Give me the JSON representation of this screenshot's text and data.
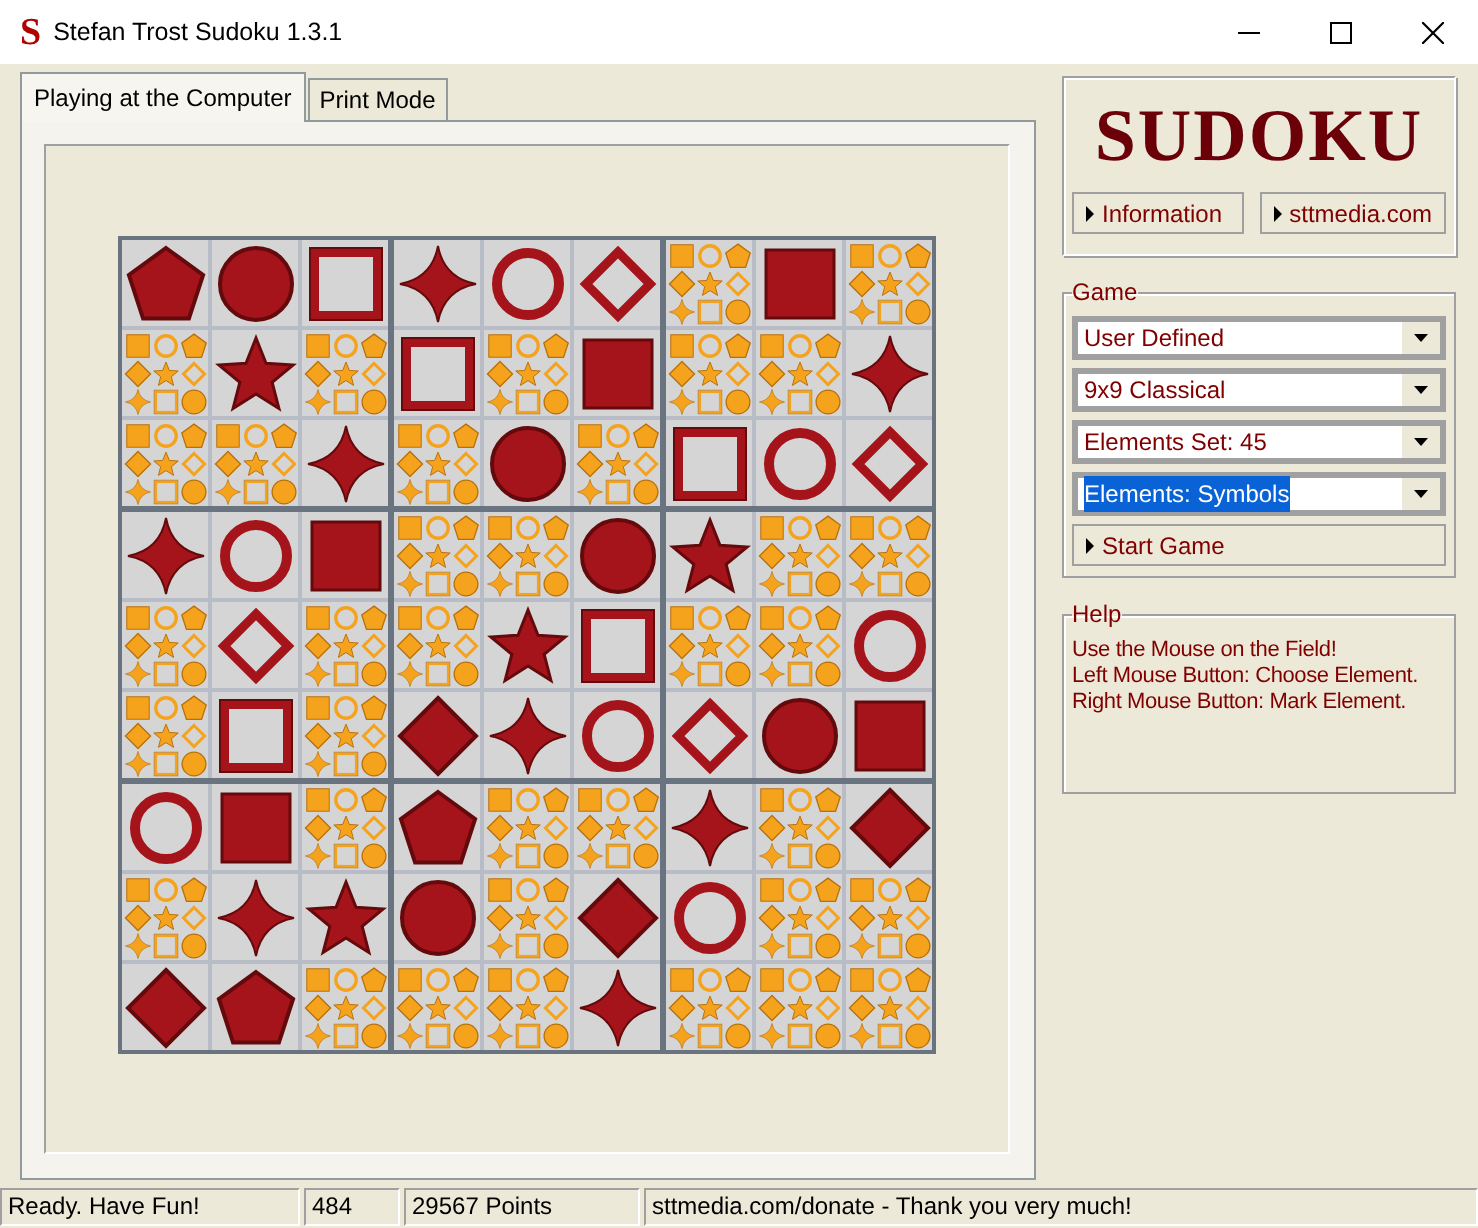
{
  "window": {
    "icon_letter": "S",
    "title": "Stefan Trost Sudoku 1.3.1"
  },
  "tabs": [
    {
      "label": "Playing at the Computer",
      "selected": true
    },
    {
      "label": "Print Mode",
      "selected": false
    }
  ],
  "board": {
    "rows": [
      [
        {
          "kind": "pentagon"
        },
        {
          "kind": "sphere"
        },
        {
          "kind": "frame"
        },
        {
          "kind": "star4"
        },
        {
          "kind": "ring"
        },
        {
          "kind": "diamond_outline"
        },
        {
          "kind": "candidates"
        },
        {
          "kind": "square"
        },
        {
          "kind": "candidates"
        }
      ],
      [
        {
          "kind": "candidates"
        },
        {
          "kind": "star5"
        },
        {
          "kind": "candidates"
        },
        {
          "kind": "frame"
        },
        {
          "kind": "candidates"
        },
        {
          "kind": "square"
        },
        {
          "kind": "candidates"
        },
        {
          "kind": "candidates"
        },
        {
          "kind": "star4"
        }
      ],
      [
        {
          "kind": "candidates"
        },
        {
          "kind": "candidates"
        },
        {
          "kind": "star4"
        },
        {
          "kind": "candidates"
        },
        {
          "kind": "sphere"
        },
        {
          "kind": "candidates"
        },
        {
          "kind": "frame"
        },
        {
          "kind": "ring"
        },
        {
          "kind": "diamond_outline"
        }
      ],
      [
        {
          "kind": "star4"
        },
        {
          "kind": "ring"
        },
        {
          "kind": "square"
        },
        {
          "kind": "candidates"
        },
        {
          "kind": "candidates"
        },
        {
          "kind": "sphere"
        },
        {
          "kind": "star5"
        },
        {
          "kind": "candidates"
        },
        {
          "kind": "candidates"
        }
      ],
      [
        {
          "kind": "candidates"
        },
        {
          "kind": "diamond_outline"
        },
        {
          "kind": "candidates"
        },
        {
          "kind": "candidates"
        },
        {
          "kind": "star5"
        },
        {
          "kind": "frame"
        },
        {
          "kind": "candidates"
        },
        {
          "kind": "candidates"
        },
        {
          "kind": "ring"
        }
      ],
      [
        {
          "kind": "candidates"
        },
        {
          "kind": "frame"
        },
        {
          "kind": "candidates"
        },
        {
          "kind": "diamond"
        },
        {
          "kind": "star4"
        },
        {
          "kind": "ring"
        },
        {
          "kind": "diamond_outline"
        },
        {
          "kind": "sphere"
        },
        {
          "kind": "square"
        }
      ],
      [
        {
          "kind": "ring"
        },
        {
          "kind": "square"
        },
        {
          "kind": "candidates"
        },
        {
          "kind": "pentagon"
        },
        {
          "kind": "candidates"
        },
        {
          "kind": "candidates"
        },
        {
          "kind": "star4"
        },
        {
          "kind": "candidates"
        },
        {
          "kind": "diamond"
        }
      ],
      [
        {
          "kind": "candidates"
        },
        {
          "kind": "star4"
        },
        {
          "kind": "star5"
        },
        {
          "kind": "sphere"
        },
        {
          "kind": "candidates"
        },
        {
          "kind": "diamond"
        },
        {
          "kind": "ring"
        },
        {
          "kind": "candidates"
        },
        {
          "kind": "candidates"
        }
      ],
      [
        {
          "kind": "diamond"
        },
        {
          "kind": "pentagon"
        },
        {
          "kind": "candidates"
        },
        {
          "kind": "candidates"
        },
        {
          "kind": "candidates"
        },
        {
          "kind": "star4"
        },
        {
          "kind": "candidates"
        },
        {
          "kind": "candidates"
        },
        {
          "kind": "candidates"
        }
      ]
    ]
  },
  "logo": "SUDOKU",
  "links": [
    {
      "label": "Information"
    },
    {
      "label": "sttmedia.com"
    }
  ],
  "game": {
    "title": "Game",
    "dropdowns": [
      {
        "value": "User Defined",
        "focused": false
      },
      {
        "value": "9x9 Classical",
        "focused": false
      },
      {
        "value": "Elements Set: 45",
        "focused": false
      },
      {
        "value": "Elements: Symbols",
        "focused": true
      }
    ],
    "start_button": "Start Game"
  },
  "help": {
    "title": "Help",
    "lines": [
      "Use the Mouse on the Field!",
      "Left Mouse Button: Choose Element.",
      "Right Mouse Button: Mark Element."
    ]
  },
  "status_bar": [
    "Ready. Have Fun!",
    "484",
    "29567 Points",
    "sttmedia.com/donate - Thank you very much!"
  ]
}
